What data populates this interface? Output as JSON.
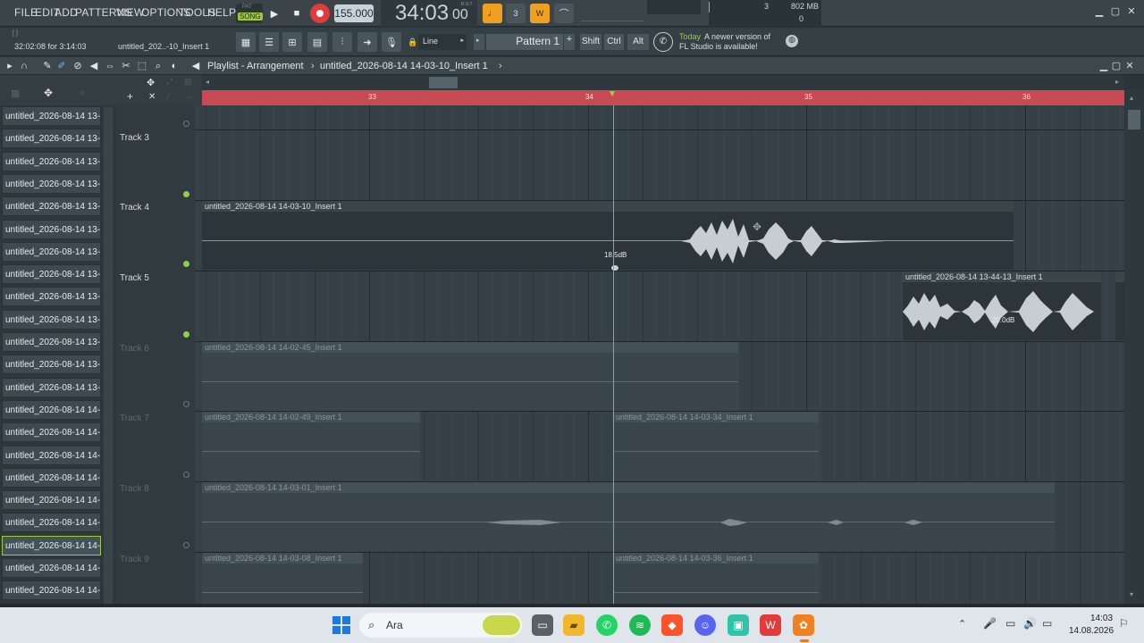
{
  "menu": [
    "FILE",
    "EDIT",
    "ADD",
    "PATTERNS",
    "VIEW",
    "OPTIONS",
    "TOOLS",
    "HELP"
  ],
  "transport": {
    "mode_pat": "PAT",
    "mode_song": "SONG",
    "tempo": "155.000",
    "time_main": "34:03",
    "time_sub": "00",
    "time_sig": "B:S:T",
    "cpu_value": "3",
    "ram_value": "802 MB",
    "poly_value": "0"
  },
  "hint": {
    "time_left": "32:02:08 for 3:14:03",
    "file": "untitled_202..-10_Insert 1"
  },
  "snap_mode": "Line",
  "pattern_name": "Pattern 1",
  "modifiers": [
    "Shift",
    "Ctrl",
    "Alt"
  ],
  "news": {
    "day": "Today",
    "line1": "A newer version of",
    "line2": "FL Studio is available!"
  },
  "playlist": {
    "title": "Playlist - Arrangement",
    "separator": "›",
    "clip_name": "untitled_2026-08-14 14-03-10_Insert 1",
    "separator2": "›"
  },
  "browser_items": [
    "untitled_2026-08-14 13-...",
    "untitled_2026-08-14 13-...",
    "untitled_2026-08-14 13-...",
    "untitled_2026-08-14 13-...",
    "untitled_2026-08-14 13-...",
    "untitled_2026-08-14 13-...",
    "untitled_2026-08-14 13-...",
    "untitled_2026-08-14 13-...",
    "untitled_2026-08-14 13-...",
    "untitled_2026-08-14 13-...",
    "untitled_2026-08-14 13-...",
    "untitled_2026-08-14 13-...",
    "untitled_2026-08-14 13-...",
    "untitled_2026-08-14 14-...",
    "untitled_2026-08-14 14-...",
    "untitled_2026-08-14 14-...",
    "untitled_2026-08-14 14-...",
    "untitled_2026-08-14 14-...",
    "untitled_2026-08-14 14-...",
    "untitled_2026-08-14 14-...",
    "untitled_2026-08-14 14-...",
    "untitled_2026-08-14 14-..."
  ],
  "ruler_bars": [
    "33",
    "34",
    "35",
    "36"
  ],
  "tracks": [
    "Track 3",
    "Track 4",
    "Track 5",
    "Track 6",
    "Track 7",
    "Track 8",
    "Track 9"
  ],
  "clips": {
    "t4": "untitled_2026-08-14 14-03-10_Insert 1",
    "t5": "untitled_2026-08-14 13-44-13_Insert 1",
    "t6": "untitled_2026-08-14 14-02-45_Insert 1",
    "t7a": "untitled_2026-08-14 14-02-49_Insert 1",
    "t7b": "untitled_2026-08-14 14-03-34_Insert 1",
    "t8": "untitled_2026-08-14 14-03-01_Insert 1",
    "t9a": "untitled_2026-08-14 14-03-08_Insert 1",
    "t9b": "untitled_2026-08-14 14-03-36_Insert 1"
  },
  "db_labels": {
    "t4": "18.5dB",
    "t5": "20.0dB"
  },
  "taskbar": {
    "search": "Ara",
    "time": "14:03",
    "date": "14.08.2026"
  },
  "colors": {
    "ruler": "#c84a55",
    "accent_green": "#9ccc3c",
    "orange": "#f0a020",
    "record": "#e23b3b"
  }
}
